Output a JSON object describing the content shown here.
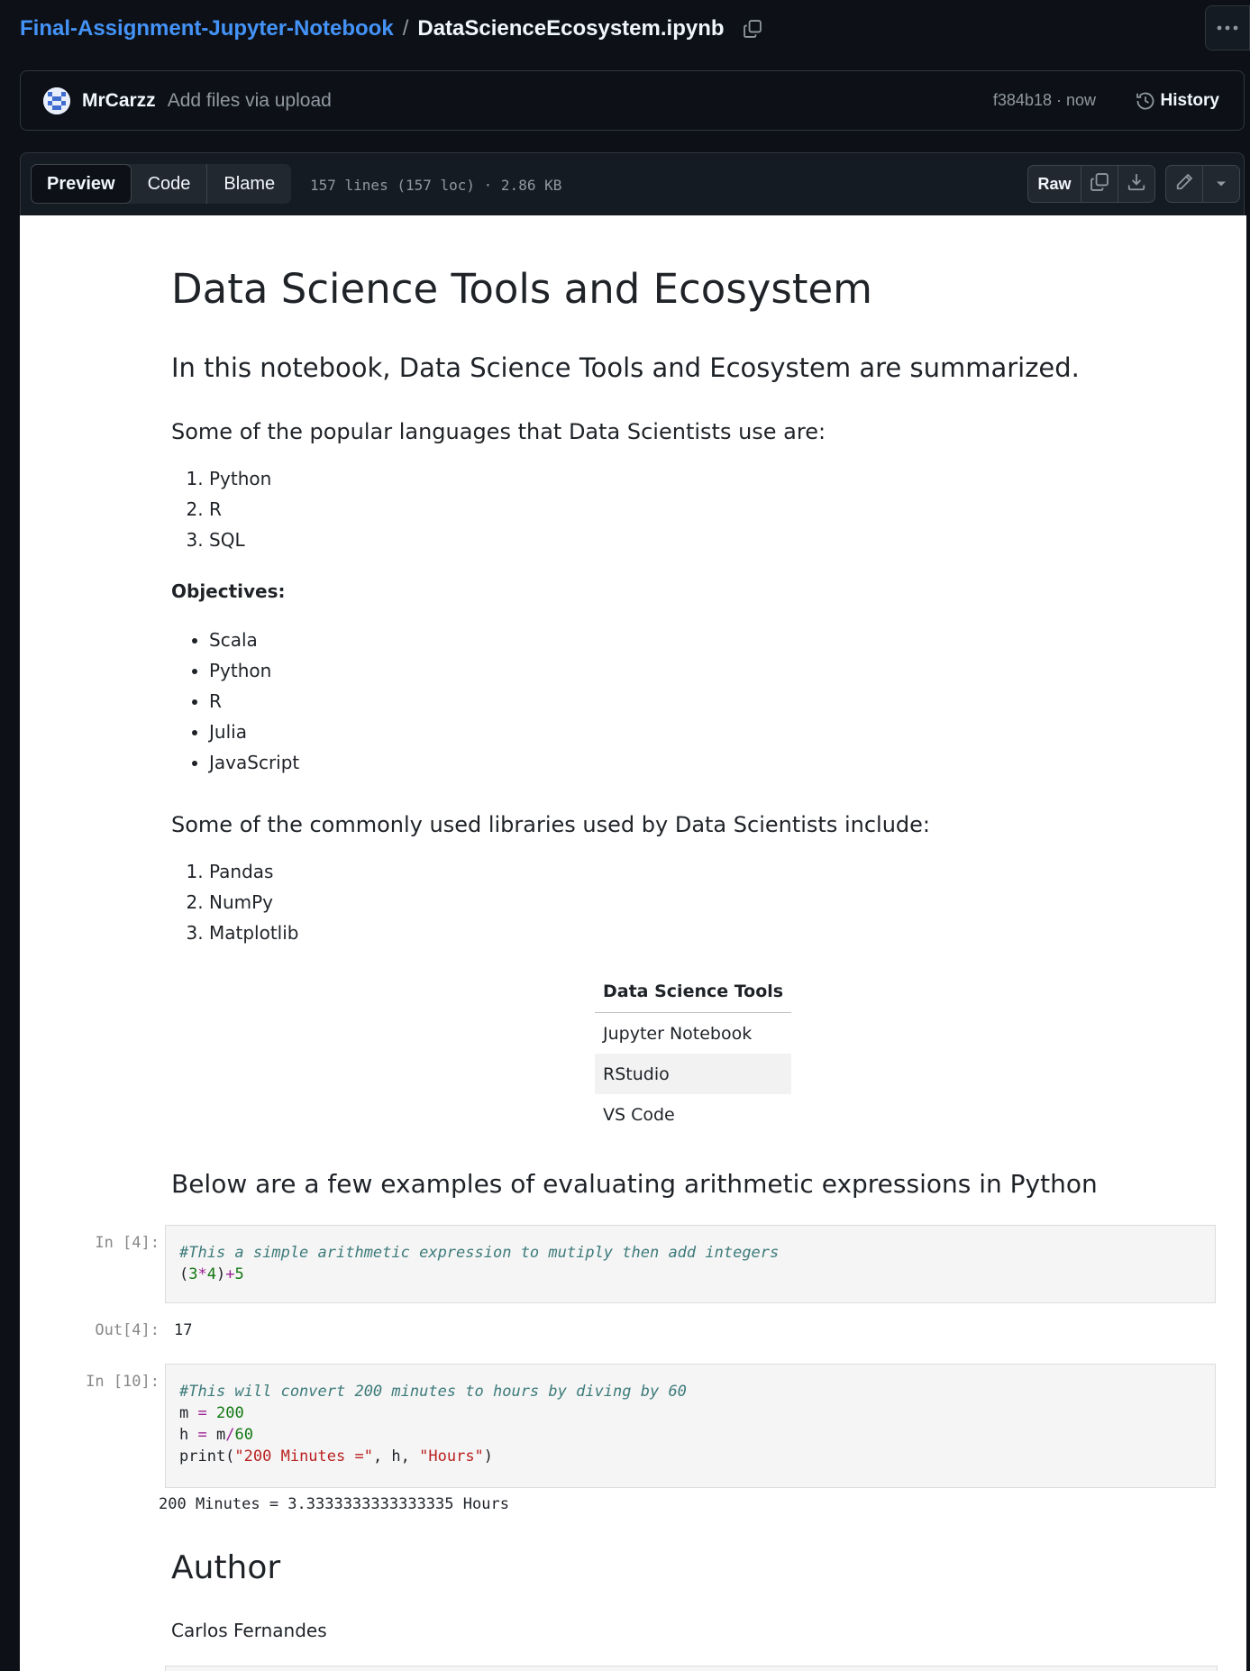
{
  "breadcrumb": {
    "repo": "Final-Assignment-Jupyter-Notebook",
    "separator": "/",
    "file": "DataScienceEcosystem.ipynb"
  },
  "commit": {
    "author": "MrCarzz",
    "message": "Add files via upload",
    "sha_time": "f384b18 · now",
    "history_label": "History"
  },
  "file_header": {
    "tabs": [
      "Preview",
      "Code",
      "Blame"
    ],
    "active_tab": "Preview",
    "meta": "157 lines (157 loc) · 2.86 KB",
    "raw_label": "Raw"
  },
  "notebook": {
    "title": "Data Science Tools and Ecosystem",
    "intro": "In this notebook, Data Science Tools and Ecosystem are summarized.",
    "languages_heading": "Some of the popular languages that Data Scientists use are:",
    "languages": [
      "Python",
      "R",
      "SQL"
    ],
    "objectives_label": "Objectives:",
    "objectives": [
      "Scala",
      "Python",
      "R",
      "Julia",
      "JavaScript"
    ],
    "libraries_heading": "Some of the commonly used libraries used by Data Scientists include:",
    "libraries": [
      "Pandas",
      "NumPy",
      "Matplotlib"
    ],
    "tools_table": {
      "header": "Data Science Tools",
      "rows": [
        "Jupyter Notebook",
        "RStudio",
        "VS Code"
      ]
    },
    "arith_heading": "Below are a few examples of evaluating arithmetic expressions in Python",
    "cells": [
      {
        "in_prompt": "In [4]:",
        "comment": "#This a simple arithmetic expression to mutiply then add integers",
        "out_prompt": "Out[4]:",
        "output": "17"
      },
      {
        "in_prompt": "In [10]:",
        "comment": "#This will convert 200 minutes to hours by diving by 60",
        "output": "200 Minutes = 3.3333333333333335 Hours"
      }
    ],
    "author_heading": "Author",
    "author_name": "Carlos Fernandes"
  },
  "icons": {
    "copy": "copy-icon",
    "history": "history-icon",
    "download": "download-icon",
    "edit": "pencil-icon",
    "more": "kebab-icon",
    "dropdown": "chevron-down-icon"
  },
  "colors": {
    "link": "#4493f8",
    "page_bg": "#0d1117",
    "notebook_bg": "#ffffff"
  }
}
